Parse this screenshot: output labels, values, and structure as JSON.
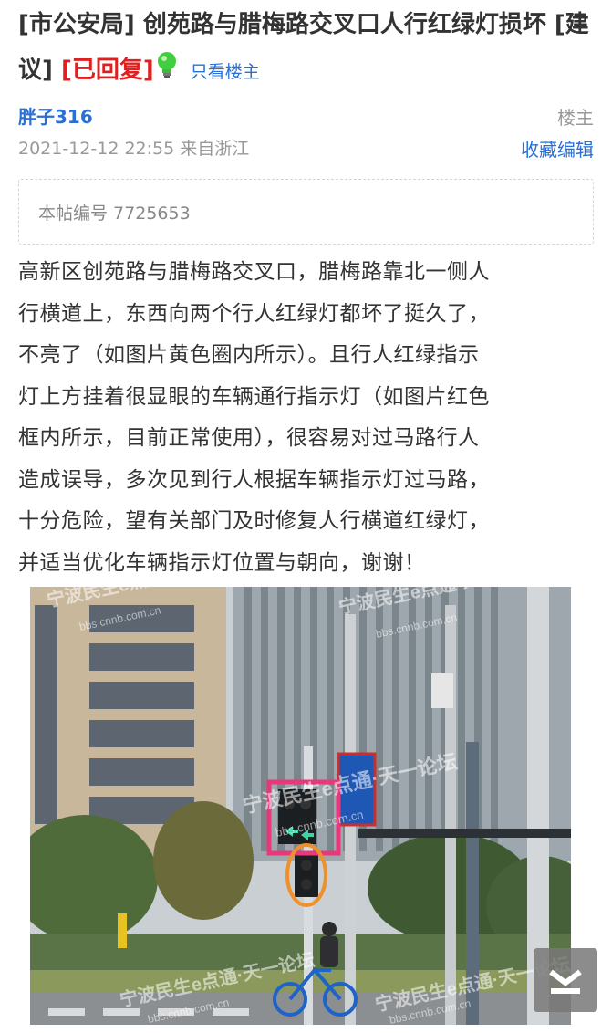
{
  "post": {
    "title_prefix": "[市公安局] 创苑路与腊梅路交叉口人行红绿灯损坏 [建议] ",
    "reply_tag": "[已回复]",
    "only_host_link": "只看楼主",
    "author": "胖子316",
    "host_label": "楼主",
    "meta": "2021-12-12 22:55 来自浙江",
    "actions": {
      "favorite": "收藏",
      "edit": "编辑"
    },
    "post_id": "本帖编号 7725653",
    "body_lines": [
      "高新区创苑路与腊梅路交叉口，腊梅路靠北一侧人",
      "行横道上，东西向两个行人红绿灯都坏了挺久了，",
      "不亮了（如图片黄色圈内所示）。且行人红绿指示",
      "灯上方挂着很显眼的车辆通行指示灯（如图片红色",
      "框内所示，目前正常使用），很容易对过马路行人",
      "造成误导，多次见到行人根据车辆指示灯过马路，",
      "十分危险，望有关部门及时修复人行横道红绿灯，",
      "并适当优化车辆指示灯位置与朝向，谢谢！"
    ]
  },
  "photo": {
    "watermark_1": "宁波民生e点通·天一论坛",
    "watermark_2": "bbs.cnnb.com.cn"
  },
  "icons": {
    "bulb": "lightbulb-icon",
    "scroll": "scroll-to-bottom-icon"
  },
  "colors": {
    "link": "#2a6fd6",
    "reply_tag": "#e02020",
    "muted": "#999999",
    "highlight_box": "#e8387a",
    "highlight_circle": "#f0902a"
  }
}
